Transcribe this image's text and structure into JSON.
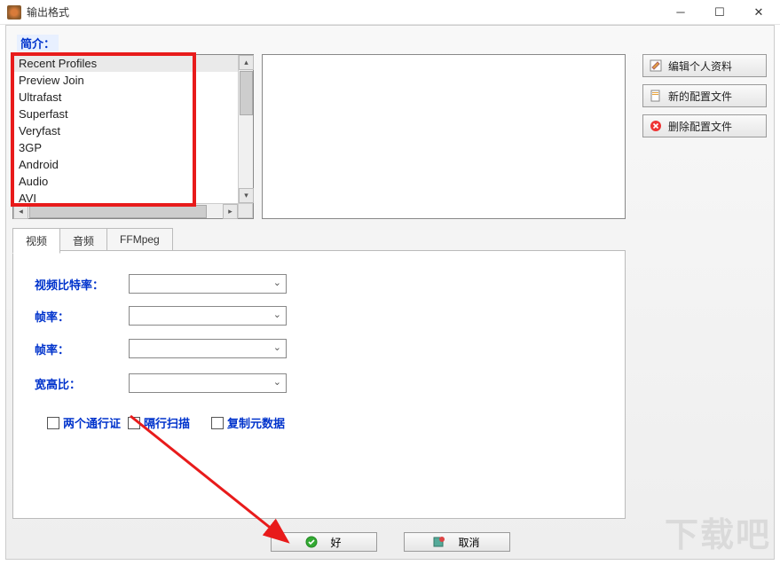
{
  "window": {
    "title": "输出格式"
  },
  "intro_label": "简介：",
  "profiles": [
    "Recent Profiles",
    "Preview Join",
    "Ultrafast",
    "Superfast",
    "Veryfast",
    "3GP",
    "Android",
    "Audio",
    "AVI"
  ],
  "side_buttons": {
    "edit": "编辑个人资料",
    "new": "新的配置文件",
    "delete": "删除配置文件"
  },
  "tabs": {
    "video": "视频",
    "audio": "音频",
    "ffmpeg": "FFMpeg"
  },
  "form": {
    "video_bitrate": "视频比特率：",
    "framerate1": "帧率：",
    "framerate2": "帧率：",
    "aspect": "宽高比："
  },
  "checkboxes": {
    "two_pass": "两个通行证",
    "interlaced": "隔行扫描",
    "copy_meta": "复制元数据"
  },
  "bottom": {
    "ok": "好",
    "cancel": "取消"
  },
  "watermark": "下载吧"
}
